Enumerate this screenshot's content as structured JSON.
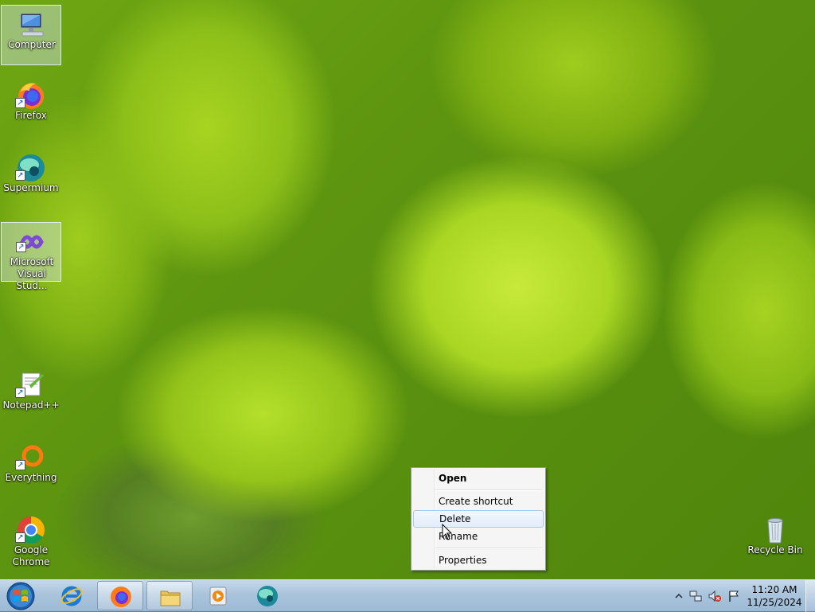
{
  "desktop": {
    "icons": [
      {
        "label": "Computer"
      },
      {
        "label": "Firefox"
      },
      {
        "label": "Supermium"
      },
      {
        "label": "Microsoft Visual Stud..."
      },
      {
        "label": "Notepad++"
      },
      {
        "label": "Everything"
      },
      {
        "label": "Google Chrome"
      },
      {
        "label": "Recycle Bin"
      }
    ]
  },
  "context_menu": {
    "items": [
      {
        "label": "Open"
      },
      {
        "label": "Create shortcut"
      },
      {
        "label": "Delete"
      },
      {
        "label": "Rename"
      },
      {
        "label": "Properties"
      }
    ]
  },
  "taskbar": {
    "pinned": [
      "internet-explorer",
      "firefox",
      "file-explorer",
      "media-player",
      "supermium"
    ],
    "tray_icons": [
      "show-hidden-icons",
      "network-icon",
      "volume-muted-icon",
      "action-center-flag-icon"
    ],
    "clock": {
      "time": "11:20 AM",
      "date": "11/25/2024"
    }
  },
  "colors": {
    "menu_hover": "#e3eefb",
    "taskbar": "#aac4dc",
    "wallpaper": "#8cbf19"
  }
}
